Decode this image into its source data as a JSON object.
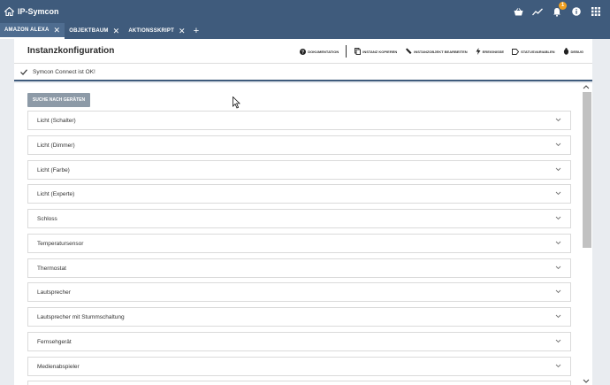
{
  "app": {
    "title": "IP-Symcon",
    "notification_count": "1"
  },
  "tabs": [
    {
      "label": "AMAZON ALEXA"
    },
    {
      "label": "OBJEKTBAUM"
    },
    {
      "label": "AKTIONSSKRIPT"
    }
  ],
  "panel": {
    "title": "Instanzkonfiguration",
    "actions": {
      "documentation": "Dokumentation",
      "copy_instance": "Instanz kopieren",
      "edit_instance": "Instanzobjekt bearbeiten",
      "events": "Ereignisse",
      "status_variables": "Statusvariablen",
      "debug": "Debug"
    }
  },
  "status": {
    "message": "Symcon Connect ist OK!"
  },
  "search_button": "SUCHE NACH GERÄTEN",
  "device_types": [
    {
      "label": "Licht (Schalter)"
    },
    {
      "label": "Licht (Dimmer)"
    },
    {
      "label": "Licht (Farbe)"
    },
    {
      "label": "Licht (Experte)"
    },
    {
      "label": "Schloss"
    },
    {
      "label": "Temperatursensor"
    },
    {
      "label": "Thermostat"
    },
    {
      "label": "Lautsprecher"
    },
    {
      "label": "Lautsprecher mit Stummschaltung"
    },
    {
      "label": "Fernsehgerät"
    },
    {
      "label": "Medienabspieler"
    },
    {
      "label": ""
    }
  ],
  "colors": {
    "header": "#3f5b7c",
    "active_tab": "#4f6d90",
    "button": "#8d9aa7",
    "badge": "#f0a020"
  }
}
